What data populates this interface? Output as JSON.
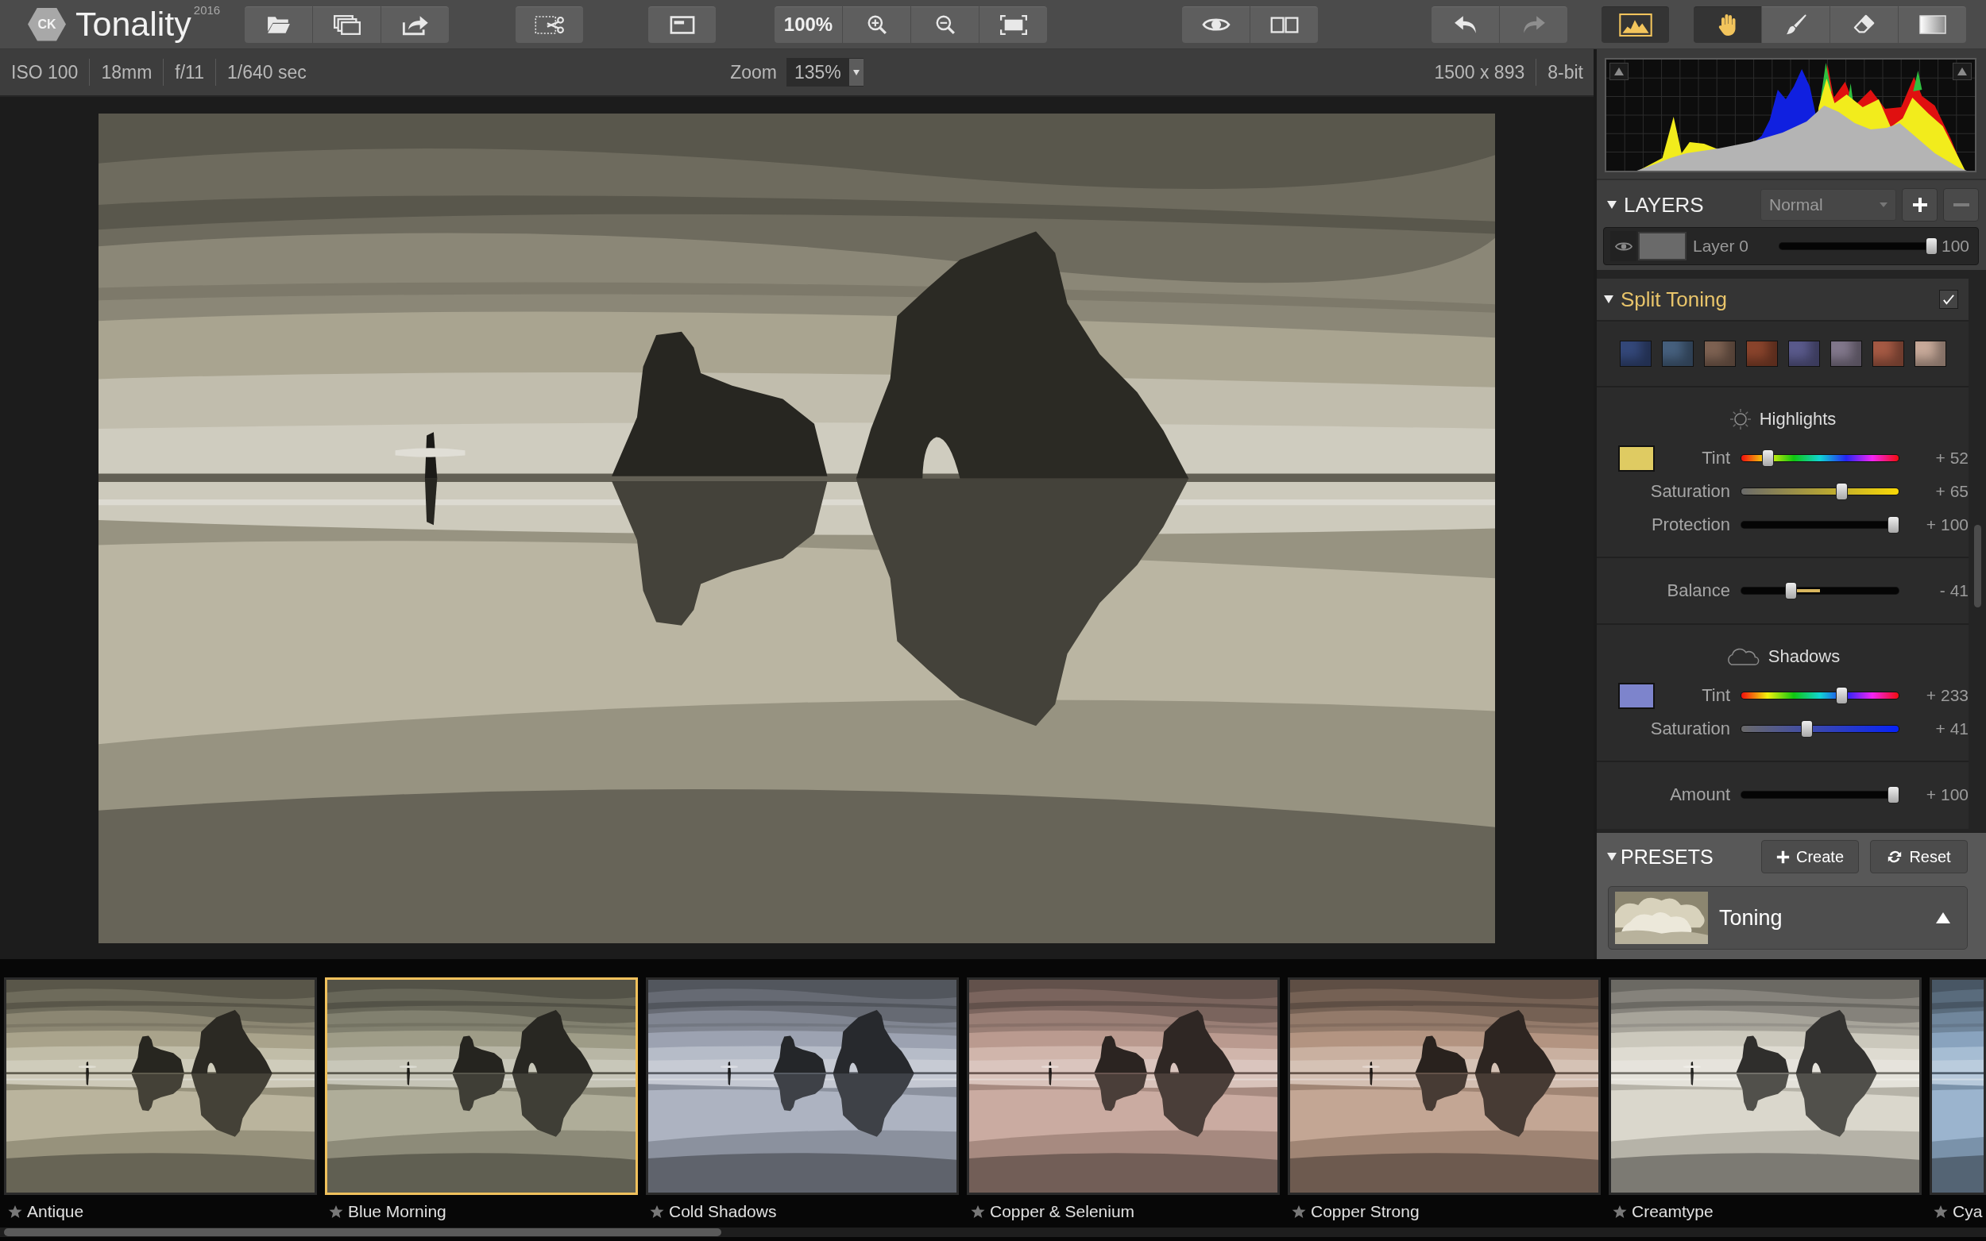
{
  "app": {
    "logo": "CK",
    "name": "Tonality",
    "version": "2016"
  },
  "toolbar": {
    "zoom_percent": "100%",
    "histogram_on": true,
    "undo": {
      "disabled": false
    },
    "redo": {
      "disabled": true
    },
    "tools": [
      {
        "kind": "hand",
        "selected": true
      },
      {
        "kind": "brush",
        "selected": false
      },
      {
        "kind": "eraser",
        "selected": false
      },
      {
        "kind": "gradient",
        "selected": false
      }
    ]
  },
  "info_bar": {
    "exif": [
      "ISO 100",
      "18mm",
      "f/11",
      "1/640 sec"
    ],
    "zoom_label": "Zoom",
    "zoom_value": "135%",
    "dimensions": "1500 x 893",
    "bit_depth": "8-bit"
  },
  "layers": {
    "title": "LAYERS",
    "expanded": true,
    "blend_mode": "Normal",
    "add_button": {
      "disabled": false
    },
    "remove_button": {
      "disabled": true
    },
    "items": [
      {
        "name": "Layer 0",
        "level": 1,
        "opacity": "100"
      }
    ]
  },
  "split_toning": {
    "title": "Split Toning",
    "expanded": true,
    "checked": true,
    "swatches": [
      {
        "color": "#34487a"
      },
      {
        "color": "#46607e"
      },
      {
        "color": "#7e6252"
      },
      {
        "color": "#8a442c"
      },
      {
        "color": "#5a5a8c"
      },
      {
        "color": "#82788c"
      },
      {
        "color": "#a65a44"
      },
      {
        "color": "#c8aa9a"
      }
    ],
    "blocks": [
      {
        "kind": "highlights",
        "title": "Highlights",
        "color": "#dfcb62",
        "sliders": [
          {
            "kind": "hue",
            "label": "Tint",
            "level": 0.145,
            "reading": "+ 52"
          },
          {
            "kind": "saturation",
            "label": "Saturation",
            "level": 0.65,
            "reading": "+ 65"
          },
          {
            "kind": "plain",
            "label": "Protection",
            "level": 1,
            "reading": "+ 100"
          }
        ]
      },
      {
        "kind": "single",
        "sliders": [
          {
            "kind": "balance",
            "label": "Balance",
            "level": 0.3,
            "reading": "- 41"
          }
        ]
      },
      {
        "kind": "shadows",
        "title": "Shadows",
        "color": "#7d84cc",
        "sliders": [
          {
            "kind": "hue",
            "label": "Tint",
            "level": 0.647,
            "reading": "+ 233"
          },
          {
            "kind": "saturation",
            "label": "Saturation",
            "level": 0.41,
            "reading": "+ 41"
          }
        ]
      },
      {
        "kind": "single",
        "sliders": [
          {
            "kind": "plain",
            "label": "Amount",
            "level": 1,
            "reading": "+ 100"
          }
        ]
      }
    ]
  },
  "presets": {
    "title": "PRESETS",
    "expanded": true,
    "create": "Create",
    "reset": "Reset",
    "category": "Toning"
  },
  "filmstrip": [
    {
      "name": "Antique",
      "color": "#b2ac92",
      "selected": false
    },
    {
      "name": "Blue Morning",
      "color": "#a6a48e",
      "selected": true
    },
    {
      "name": "Cold Shadows",
      "color": "#a4abba",
      "selected": false
    },
    {
      "name": "Copper & Selenium",
      "color": "#c4a296",
      "selected": false
    },
    {
      "name": "Copper Strong",
      "color": "#bc9c88",
      "selected": false
    },
    {
      "name": "Creamtype",
      "color": "#d6d2c6",
      "selected": false
    },
    {
      "name": "Cya",
      "color": "#90acc8",
      "selected": false
    }
  ]
}
